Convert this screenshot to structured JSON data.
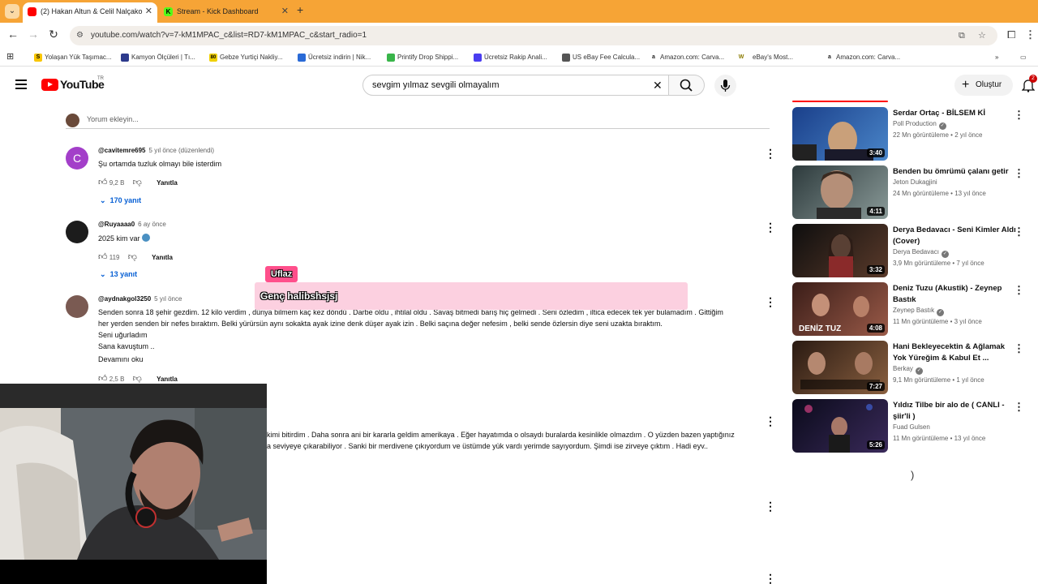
{
  "browser": {
    "tabs": [
      {
        "title": "(2) Hakan Altun & Celil Nalçako",
        "active": true,
        "favicon_color": "#ff0000"
      },
      {
        "title": "Stream - Kick Dashboard",
        "active": false,
        "favicon_color": "#53fc18"
      }
    ],
    "url": "youtube.com/watch?v=7-kM1MPAC_c&list=RD7-kM1MPAC_c&start_radio=1",
    "bookmarks": [
      {
        "label": "Yolaşan Yük Taşımac...",
        "color": "#f9c600",
        "glyph": "S"
      },
      {
        "label": "Kamyon Ölçüleri | Tı...",
        "color": "#2d3a8c",
        "glyph": ""
      },
      {
        "label": "Gebze Yurtiçi Nakliy...",
        "color": "#f0d000",
        "glyph": "80"
      },
      {
        "label": "Ücretsiz indirin | Nik...",
        "color": "#2a6ad6",
        "glyph": ""
      },
      {
        "label": "Printify Drop Shippi...",
        "color": "#39b54a",
        "glyph": ""
      },
      {
        "label": "Ücretsiz Rakip Anali...",
        "color": "#4a3df0",
        "glyph": ""
      },
      {
        "label": "US eBay Fee Calcula...",
        "color": "#555555",
        "glyph": ""
      },
      {
        "label": "Amazon.com: Carva...",
        "color": "#222222",
        "glyph": "a"
      },
      {
        "label": "eBay's Most...",
        "color": "#c8b400",
        "glyph": "W"
      },
      {
        "label": "Amazon.com: Carva...",
        "color": "#222222",
        "glyph": "a"
      }
    ]
  },
  "youtube": {
    "logo_text": "YouTube",
    "region": "TR",
    "search_query": "sevgim yılmaz sevgili olmayalım",
    "create_label": "Oluştur",
    "notification_count": "2"
  },
  "comments": {
    "add_placeholder": "Yorum ekleyin...",
    "reply_label": "Yanıtla",
    "items": [
      {
        "handle": "@cavitemre695",
        "time": "5 yıl önce (düzenlendi)",
        "text": "Şu ortamda tuzluk olmayı bile isterdim",
        "likes": "9,2 B",
        "replies": "170 yanıt",
        "avatar_color": "#a33fc9",
        "avatar_letter": "C"
      },
      {
        "handle": "@Ruyaaaa0",
        "time": "6 ay önce",
        "text": "2025 kim var",
        "likes": "119",
        "replies": "13 yanıt",
        "avatar_color": "#1c1c1c",
        "avatar_letter": ""
      },
      {
        "handle": "@aydnakgol3250",
        "time": "5 yıl önce",
        "text_lines": [
          "Senden sonra 18 şehir gezdim. 12 kilo verdim , dünya bilmem kaç kez döndü . Darbe oldu , ihtilal oldu . Savaş bitmedi barış hiç gelmedi . Seni özledim , iltica edecek tek yer bulamadım . Gittiğim",
          "her yerden senden bir nefes bıraktım. Belki yürürsün aynı sokakta ayak izine denk düşer ayak izin . Belki saçına değer nefesim , belki sende özlersin diye seni uzakta bıraktım.",
          "Seni uğurladım",
          "Sana kavuştum .."
        ],
        "read_more": "Devamını oku",
        "likes": "2,5 B",
        "avatar_color": "#7a5a52",
        "avatar_letter": ""
      }
    ],
    "partial_text_lines": [
      "kimi bitirdim . Daha sonra ani bir kararla geldim amerikaya . Eğer hayatımda o olsaydı buralarda kesinlikle olmazdım . O yüzden bazen yaptığınız",
      "a seviyeye çıkarabiliyor . Sanki bir merdivene çıkıyordum ve üstümde yük vardı yerimde sayıyordum. Şimdi ise zirveye çıktım . Hadi eyv.."
    ]
  },
  "overlay": {
    "username": "Uflaz",
    "message": "Genç halibshsjsj"
  },
  "sidebar": {
    "items": [
      {
        "title": "Serdar Ortaç - BİLSEM Kİ",
        "channel": "Poll Production",
        "verified": true,
        "views": "22 Mn görüntüleme",
        "age": "2 yıl önce",
        "duration": "3:40",
        "thumb_a": "#1a3f8a",
        "thumb_b": "#4a86c9"
      },
      {
        "title": "Benden bu ömrümü çalanı getir",
        "channel": "Jeton Dukagjini",
        "verified": false,
        "views": "24 Mn görüntüleme",
        "age": "13 yıl önce",
        "duration": "4:11",
        "thumb_a": "#2d3a3c",
        "thumb_b": "#8a9a98"
      },
      {
        "title": "Derya Bedavacı - Seni Kimler Aldı (Cover)",
        "channel": "Derya Bedavacı",
        "verified": true,
        "views": "3,9 Mn görüntüleme",
        "age": "7 yıl önce",
        "duration": "3:32",
        "thumb_a": "#0e0e0e",
        "thumb_b": "#5a3a2a"
      },
      {
        "title": "Deniz Tuzu (Akustik) - Zeynep Bastık",
        "channel": "Zeynep Bastık",
        "verified": true,
        "views": "11 Mn görüntüleme",
        "age": "3 yıl önce",
        "duration": "4:08",
        "thumb_a": "#3a1d18",
        "thumb_b": "#9a5a48",
        "overlay_text": "DENİZ TUZ"
      },
      {
        "title": "Hani Bekleyecektin & Ağlamak Yok Yüreğim & Kabul Et ...",
        "channel": "Berkay",
        "verified": true,
        "views": "9,1 Mn görüntüleme",
        "age": "1 yıl önce",
        "duration": "7:27",
        "thumb_a": "#2a1a12",
        "thumb_b": "#8a6040"
      },
      {
        "title": "Yıldız Tilbe bir alo de ( CANLI - şiir'li )",
        "channel": "Fuad Gulsen",
        "verified": false,
        "views": "11 Mn görüntüleme",
        "age": "13 yıl önce",
        "duration": "5:26",
        "thumb_a": "#0a0a1a",
        "thumb_b": "#3a2a5a"
      }
    ]
  }
}
